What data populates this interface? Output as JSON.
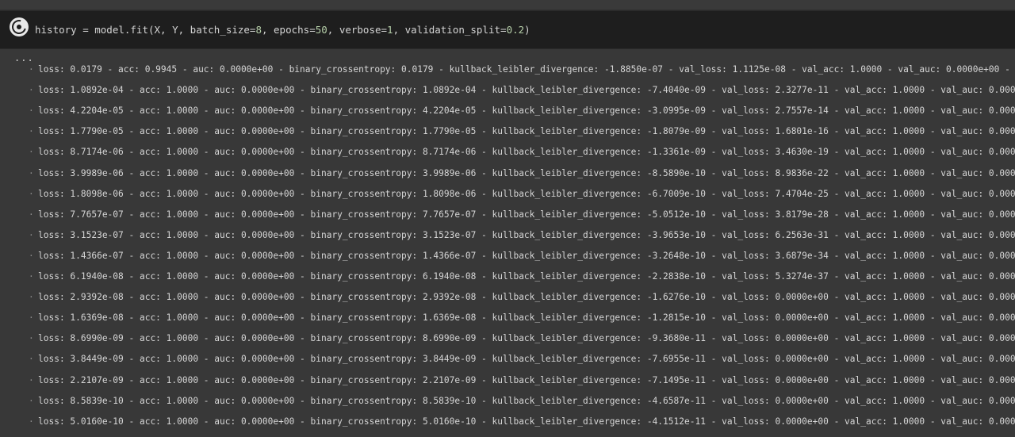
{
  "cell": {
    "code_parts": [
      "history = model.fit(X, Y, batch_size=",
      "8",
      ", epochs=",
      "50",
      ", verbose=",
      "1",
      ", validation_split=",
      "0.2",
      ")"
    ]
  },
  "output": {
    "ellipsis": "...",
    "bullet": "·",
    "lines": [
      "loss: 0.0179 - acc: 0.9945 - auc: 0.0000e+00 - binary_crossentropy: 0.0179 - kullback_leibler_divergence: -1.8850e-07 - val_loss: 1.1125e-08 - val_acc: 1.0000 - val_auc: 0.0000e+00 - v",
      "loss: 1.0892e-04 - acc: 1.0000 - auc: 0.0000e+00 - binary_crossentropy: 1.0892e-04 - kullback_leibler_divergence: -7.4040e-09 - val_loss: 2.3277e-11 - val_acc: 1.0000 - val_auc: 0.000",
      "loss: 4.2204e-05 - acc: 1.0000 - auc: 0.0000e+00 - binary_crossentropy: 4.2204e-05 - kullback_leibler_divergence: -3.0995e-09 - val_loss: 2.7557e-14 - val_acc: 1.0000 - val_auc: 0.000",
      "loss: 1.7790e-05 - acc: 1.0000 - auc: 0.0000e+00 - binary_crossentropy: 1.7790e-05 - kullback_leibler_divergence: -1.8079e-09 - val_loss: 1.6801e-16 - val_acc: 1.0000 - val_auc: 0.000",
      "loss: 8.7174e-06 - acc: 1.0000 - auc: 0.0000e+00 - binary_crossentropy: 8.7174e-06 - kullback_leibler_divergence: -1.3361e-09 - val_loss: 3.4630e-19 - val_acc: 1.0000 - val_auc: 0.000",
      "loss: 3.9989e-06 - acc: 1.0000 - auc: 0.0000e+00 - binary_crossentropy: 3.9989e-06 - kullback_leibler_divergence: -8.5890e-10 - val_loss: 8.9836e-22 - val_acc: 1.0000 - val_auc: 0.000",
      "loss: 1.8098e-06 - acc: 1.0000 - auc: 0.0000e+00 - binary_crossentropy: 1.8098e-06 - kullback_leibler_divergence: -6.7009e-10 - val_loss: 7.4704e-25 - val_acc: 1.0000 - val_auc: 0.000",
      "loss: 7.7657e-07 - acc: 1.0000 - auc: 0.0000e+00 - binary_crossentropy: 7.7657e-07 - kullback_leibler_divergence: -5.0512e-10 - val_loss: 3.8179e-28 - val_acc: 1.0000 - val_auc: 0.000",
      "loss: 3.1523e-07 - acc: 1.0000 - auc: 0.0000e+00 - binary_crossentropy: 3.1523e-07 - kullback_leibler_divergence: -3.9653e-10 - val_loss: 6.2563e-31 - val_acc: 1.0000 - val_auc: 0.000",
      "loss: 1.4366e-07 - acc: 1.0000 - auc: 0.0000e+00 - binary_crossentropy: 1.4366e-07 - kullback_leibler_divergence: -3.2648e-10 - val_loss: 3.6879e-34 - val_acc: 1.0000 - val_auc: 0.000",
      "loss: 6.1940e-08 - acc: 1.0000 - auc: 0.0000e+00 - binary_crossentropy: 6.1940e-08 - kullback_leibler_divergence: -2.2838e-10 - val_loss: 5.3274e-37 - val_acc: 1.0000 - val_auc: 0.000",
      "loss: 2.9392e-08 - acc: 1.0000 - auc: 0.0000e+00 - binary_crossentropy: 2.9392e-08 - kullback_leibler_divergence: -1.6276e-10 - val_loss: 0.0000e+00 - val_acc: 1.0000 - val_auc: 0.000",
      "loss: 1.6369e-08 - acc: 1.0000 - auc: 0.0000e+00 - binary_crossentropy: 1.6369e-08 - kullback_leibler_divergence: -1.2815e-10 - val_loss: 0.0000e+00 - val_acc: 1.0000 - val_auc: 0.000",
      "loss: 8.6990e-09 - acc: 1.0000 - auc: 0.0000e+00 - binary_crossentropy: 8.6990e-09 - kullback_leibler_divergence: -9.3680e-11 - val_loss: 0.0000e+00 - val_acc: 1.0000 - val_auc: 0.000",
      "loss: 3.8449e-09 - acc: 1.0000 - auc: 0.0000e+00 - binary_crossentropy: 3.8449e-09 - kullback_leibler_divergence: -7.6955e-11 - val_loss: 0.0000e+00 - val_acc: 1.0000 - val_auc: 0.000",
      "loss: 2.2107e-09 - acc: 1.0000 - auc: 0.0000e+00 - binary_crossentropy: 2.2107e-09 - kullback_leibler_divergence: -7.1495e-11 - val_loss: 0.0000e+00 - val_acc: 1.0000 - val_auc: 0.000",
      "loss: 8.5839e-10 - acc: 1.0000 - auc: 0.0000e+00 - binary_crossentropy: 8.5839e-10 - kullback_leibler_divergence: -4.6587e-11 - val_loss: 0.0000e+00 - val_acc: 1.0000 - val_auc: 0.000",
      "loss: 5.0160e-10 - acc: 1.0000 - auc: 0.0000e+00 - binary_crossentropy: 5.0160e-10 - kullback_leibler_divergence: -4.1512e-11 - val_loss: 0.0000e+00 - val_acc: 1.0000 - val_auc: 0.000"
    ]
  },
  "colors": {
    "background": "#383838",
    "cell_background": "#1e1e1e",
    "code_text": "#d4d4d4",
    "number_literal": "#b5cea8",
    "output_text": "#d6d6d6"
  },
  "icons": {
    "run_button": "run-cell-icon"
  }
}
